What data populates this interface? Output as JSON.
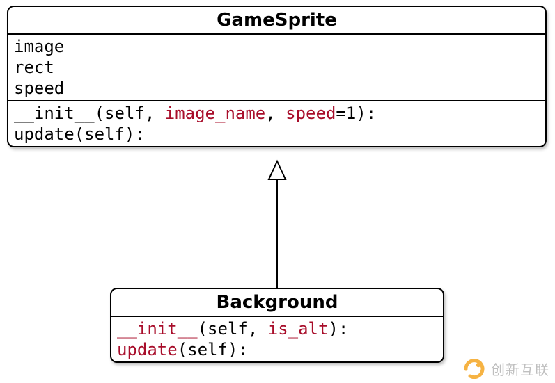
{
  "classes": {
    "parent": {
      "name": "GameSprite",
      "attributes": [
        "image",
        "rect",
        "speed"
      ],
      "methods": [
        {
          "name": "__init__",
          "params": [
            {
              "text": "self",
              "hl": false
            },
            {
              "text": "image_name",
              "hl": true
            },
            {
              "text": "speed",
              "hl": true,
              "default": "1"
            }
          ]
        },
        {
          "name": "update",
          "params": [
            {
              "text": "self",
              "hl": false
            }
          ]
        }
      ]
    },
    "child": {
      "name": "Background",
      "methods": [
        {
          "name": "__init__",
          "hl_name": true,
          "params": [
            {
              "text": "self",
              "hl": false
            },
            {
              "text": "is_alt",
              "hl": true
            }
          ]
        },
        {
          "name": "update",
          "hl_name": true,
          "params": [
            {
              "text": "self",
              "hl": false
            }
          ]
        }
      ]
    }
  },
  "watermark": "创新互联",
  "colors": {
    "highlight": "#a80d2a"
  }
}
